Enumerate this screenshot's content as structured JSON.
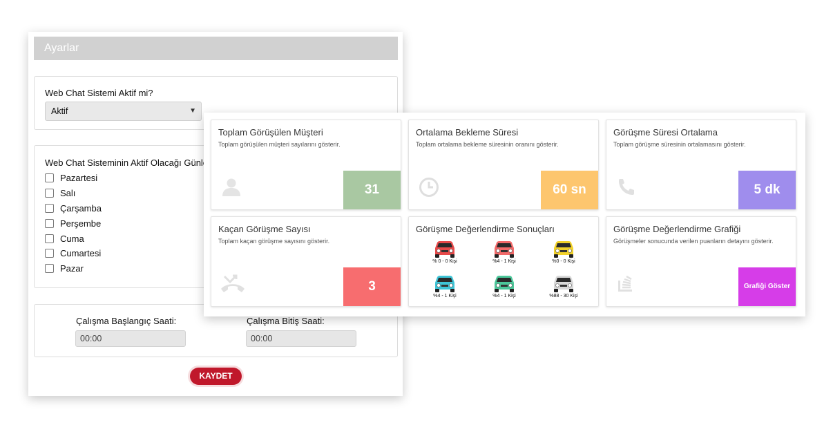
{
  "settings": {
    "header": "Ayarlar",
    "active_label": "Web Chat Sistemi Aktif mi?",
    "active_value": "Aktif",
    "days_label": "Web Chat Sisteminin Aktif Olacağı Günler",
    "days": [
      "Pazartesi",
      "Salı",
      "Çarşamba",
      "Perşembe",
      "Cuma",
      "Cumartesi",
      "Pazar"
    ],
    "start_label": "Çalışma Başlangıç Saati:",
    "start_value": "00:00",
    "end_label": "Çalışma Bitiş Saati:",
    "end_value": "00:00",
    "save_label": "KAYDET"
  },
  "cards": [
    {
      "title": "Toplam Görüşülen Müşteri",
      "sub": "Toplam görüşülen müşteri sayılarını gösterir.",
      "value": "31",
      "color": "#a9c8a2",
      "icon": "user-icon"
    },
    {
      "title": "Ortalama Bekleme Süresi",
      "sub": "Toplam ortalama bekleme süresinin oranını gösterir.",
      "value": "60 sn",
      "color": "#fdc66e",
      "icon": "clock-icon"
    },
    {
      "title": "Görüşme Süresi Ortalama",
      "sub": "Toplam görüşme süresinin ortalamasını gösterir.",
      "value": "5 dk",
      "color": "#9f8ded",
      "icon": "phone-icon"
    },
    {
      "title": "Kaçan Görüşme Sayısı",
      "sub": "Toplam kaçan görüşme sayısını gösterir.",
      "value": "3",
      "color": "#f76d6f",
      "icon": "missed-call-icon"
    },
    {
      "title": "Görüşme Değerlendirme Sonuçları",
      "icon": "car-icon"
    },
    {
      "title": "Görüşme Değerlendirme Grafiği",
      "sub": "Görüşmeler sonucunda verilen puanların detayını gösterir.",
      "value": "Grafiği Göster",
      "color": "#d63de8",
      "icon": "stack-icon"
    }
  ],
  "ratings": [
    {
      "label": "% 0 - 0 Kişi",
      "color": "#e84a4a"
    },
    {
      "label": "%4 - 1 Kişi",
      "color": "#f26a6a"
    },
    {
      "label": "%0 - 0 Kişi",
      "color": "#f2d22a"
    },
    {
      "label": "%4 - 1 Kişi",
      "color": "#3ec4d6"
    },
    {
      "label": "%4 - 1 Kişi",
      "color": "#4cc79a"
    },
    {
      "label": "%88 - 30 Kişi",
      "color": "#d9d9d9"
    }
  ]
}
